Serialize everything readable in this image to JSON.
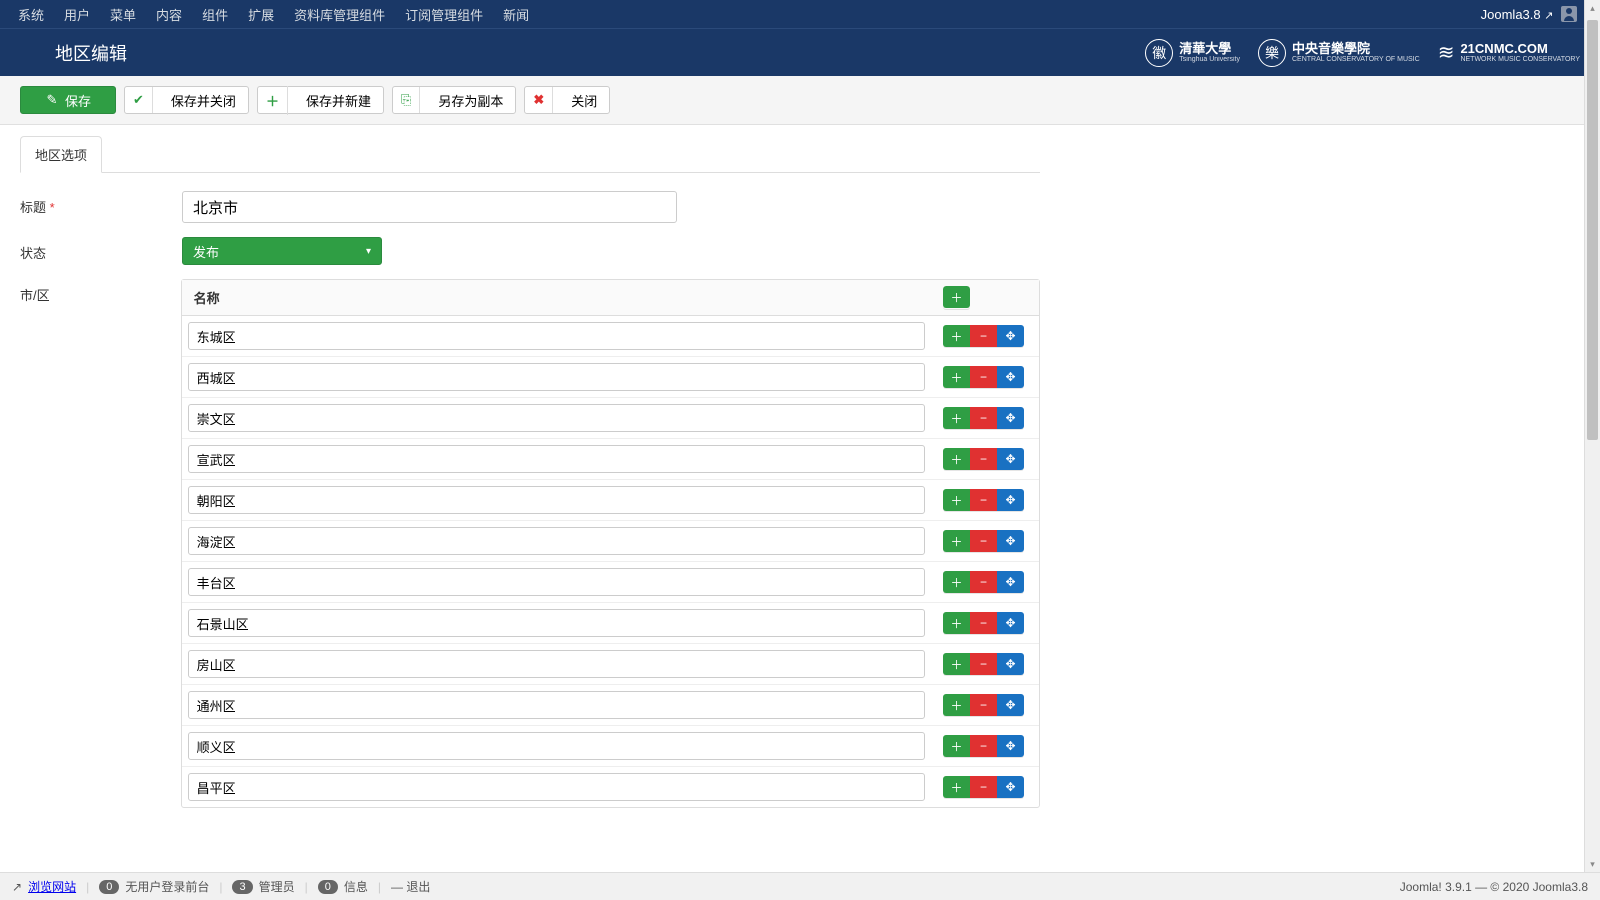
{
  "topnav": {
    "items": [
      "系统",
      "用户",
      "菜单",
      "内容",
      "组件",
      "扩展",
      "资料库管理组件",
      "订阅管理组件",
      "新闻"
    ],
    "brand": "Joomla3.8"
  },
  "header": {
    "title": "地区编辑",
    "logos": [
      {
        "mark": "徽",
        "big": "清華大學",
        "small": "Tsinghua University"
      },
      {
        "mark": "樂",
        "big": "中央音樂學院",
        "small": "CENTRAL CONSERVATORY OF MUSIC"
      },
      {
        "mark": "≋",
        "big": "21CNMC.COM",
        "small": "NETWORK MUSIC CONSERVATORY"
      }
    ]
  },
  "toolbar": {
    "save": "保存",
    "save_close": "保存并关闭",
    "save_new": "保存并新建",
    "save_copy": "另存为副本",
    "close": "关闭"
  },
  "tabs": {
    "options": "地区选项"
  },
  "form": {
    "title_label": "标题",
    "title_value": "北京市",
    "status_label": "状态",
    "status_value": "发布",
    "districts_label": "市/区",
    "name_column": "名称",
    "rows": [
      "东城区",
      "西城区",
      "崇文区",
      "宣武区",
      "朝阳区",
      "海淀区",
      "丰台区",
      "石景山区",
      "房山区",
      "通州区",
      "顺义区",
      "昌平区"
    ]
  },
  "statusbar": {
    "view_site": "浏览网站",
    "no_login_count": "0",
    "no_login_label": "无用户登录前台",
    "admin_count": "3",
    "admin_label": "管理员",
    "msg_count": "0",
    "msg_label": "信息",
    "logout": "— 退出",
    "right": "Joomla! 3.9.1  —  © 2020 Joomla3.8"
  }
}
